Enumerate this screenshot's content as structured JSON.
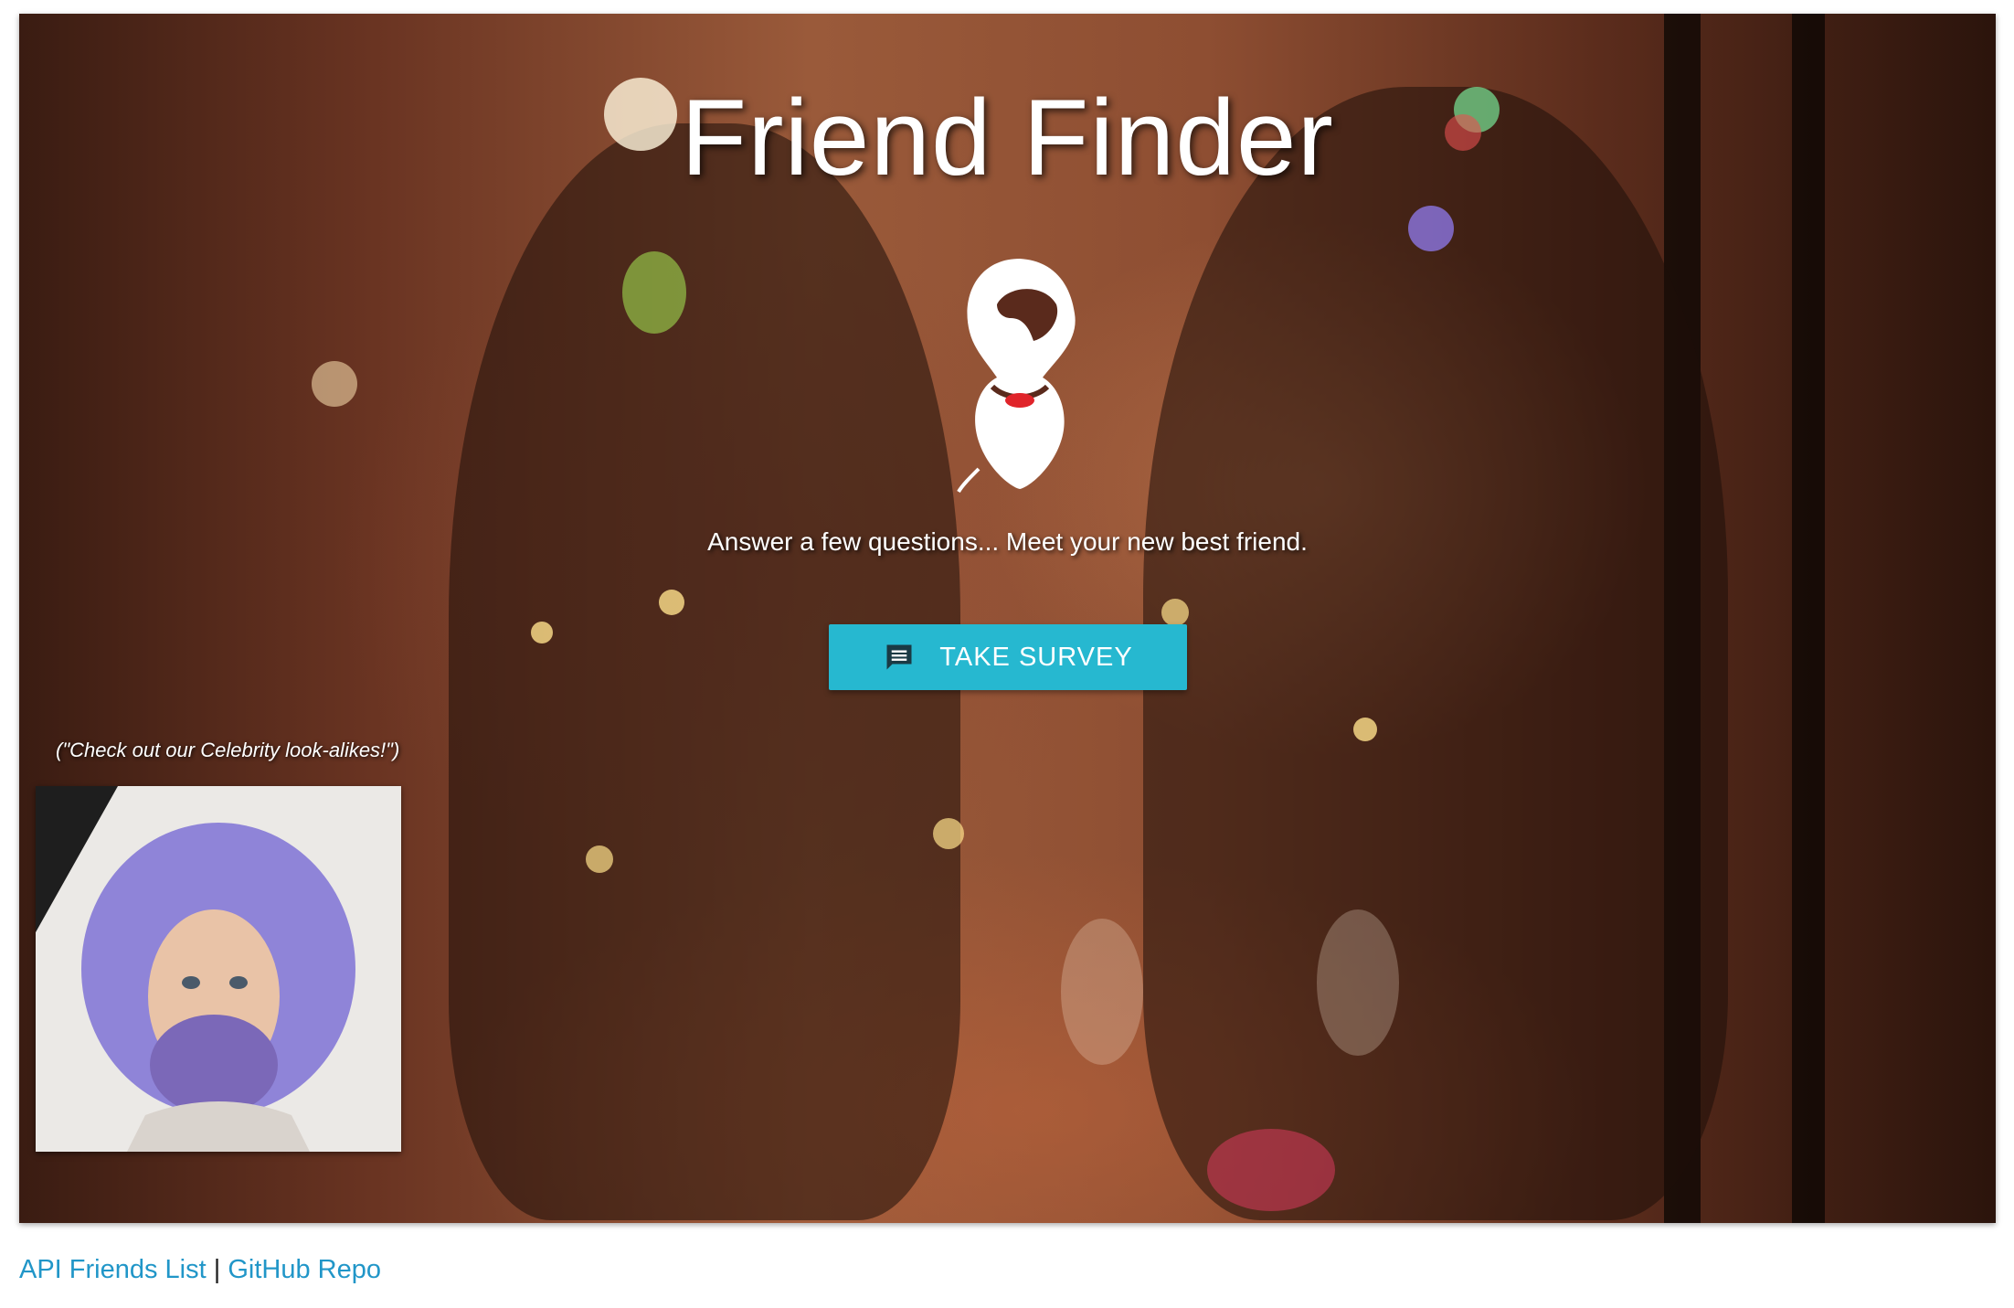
{
  "hero": {
    "title": "Friend Finder",
    "logo_icon": "bearded-woman-logo",
    "tagline": "Answer a few questions... Meet your new best friend.",
    "survey_button": {
      "label": "TAKE SURVEY",
      "icon": "chat-bubble-icon",
      "color": "#26b8d0"
    },
    "celebrity": {
      "caption": "(\"Check out our Celebrity look-alikes!\")",
      "photo": "celebrity-lookalike-photo"
    }
  },
  "footer": {
    "api_link": "API Friends List",
    "separator": "|",
    "github_link": "GitHub Repo",
    "link_color": "#2196c8"
  }
}
